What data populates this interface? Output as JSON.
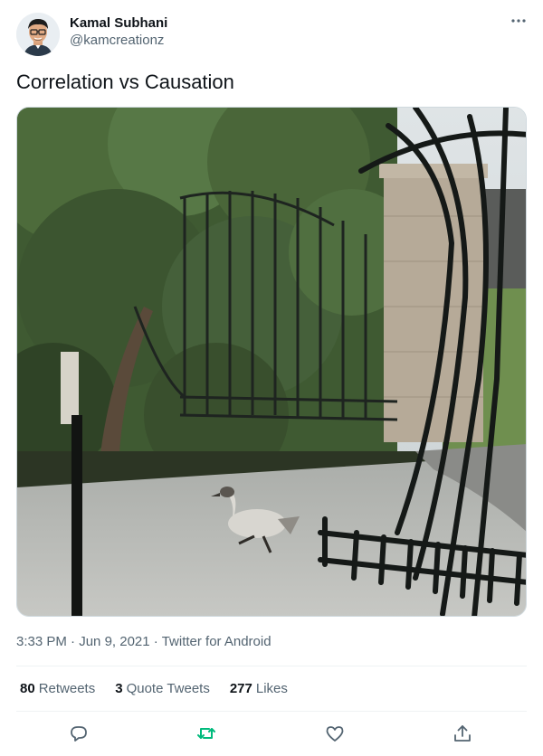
{
  "author": {
    "display_name": "Kamal Subhani",
    "handle": "@kamcreationz"
  },
  "menu_icon": "more-dots-icon",
  "tweet": {
    "text": "Correlation vs Causation"
  },
  "meta": {
    "time": "3:33 PM",
    "separator1": " · ",
    "date": "Jun 9, 2021",
    "separator2": " · ",
    "source": "Twitter for Android"
  },
  "stats": {
    "retweets_count": "80",
    "retweets_label": "Retweets",
    "quotes_count": "3",
    "quotes_label": "Quote Tweets",
    "likes_count": "277",
    "likes_label": "Likes"
  },
  "actions": {
    "reply_icon": "reply-icon",
    "retweet_icon": "retweet-icon",
    "like_icon": "heart-icon",
    "share_icon": "share-icon",
    "retweet_color": "#00ba7c",
    "icon_color": "#536471"
  }
}
